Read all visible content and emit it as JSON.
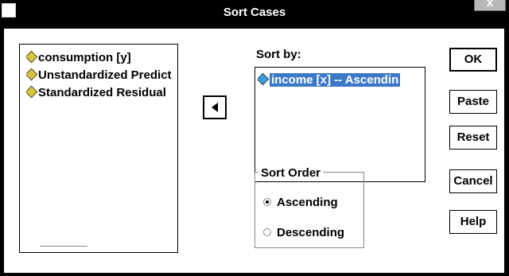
{
  "window": {
    "title": "Sort Cases",
    "close_label": "x"
  },
  "source_list": {
    "items": [
      {
        "label": "consumption [y]",
        "icon": "scale-variable-icon"
      },
      {
        "label": "Unstandardized Predict",
        "icon": "scale-variable-icon"
      },
      {
        "label": "Standardized Residual",
        "icon": "scale-variable-icon"
      }
    ]
  },
  "move_button": {
    "icon": "left-arrow-icon"
  },
  "sort_by": {
    "label": "Sort by:",
    "items": [
      {
        "label": "income [x] -- Ascendin",
        "icon": "scale-variable-icon",
        "selected": true
      }
    ]
  },
  "sort_order": {
    "legend": "Sort Order",
    "options": [
      {
        "label": "Ascending",
        "selected": true
      },
      {
        "label": "Descending",
        "selected": false
      }
    ]
  },
  "buttons": {
    "ok": "OK",
    "paste": "Paste",
    "reset": "Reset",
    "cancel": "Cancel",
    "help": "Help"
  },
  "colors": {
    "title_bar": "#000000",
    "selection": "#3c78c8"
  }
}
